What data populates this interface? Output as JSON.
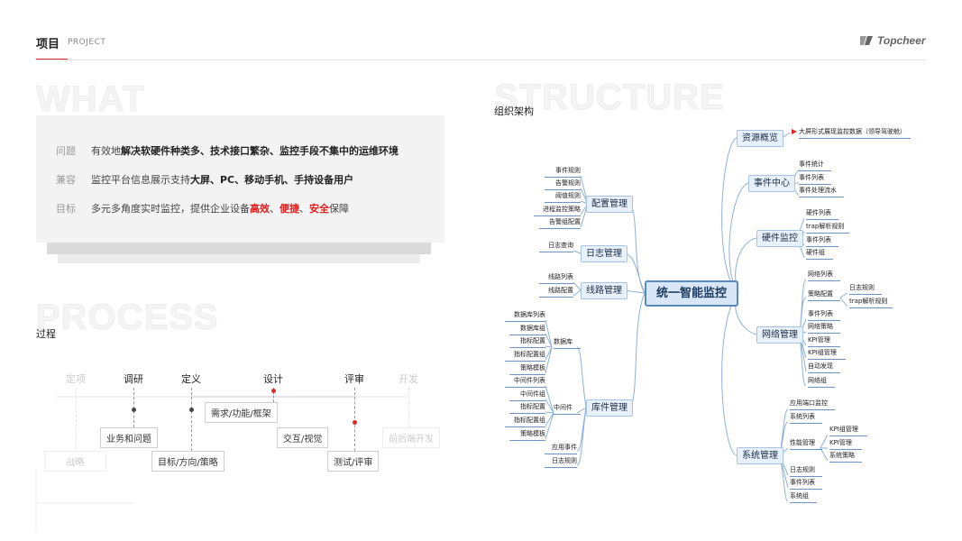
{
  "header": {
    "title": "项目",
    "subtitle": "PROJECT",
    "brand": "Topcheer"
  },
  "bg_words": {
    "what": "WHAT",
    "structure": "STRUCTURE",
    "process": "PROCESS"
  },
  "info": {
    "row1": {
      "key": "问题",
      "pre": "有效地",
      "strong": "解决软硬件种类多、技术接口繁杂、监控手段不集中的运维环境"
    },
    "row2": {
      "key": "兼容",
      "pre": "监控平台信息展示支持",
      "strong": "大屏、PC、移动手机、手持设备用户"
    },
    "row3": {
      "key": "目标",
      "pre": "多元多角度实时监控，提供企业设备",
      "red1": "高效",
      "sep1": "、",
      "red2": "便捷",
      "sep2": "、",
      "red3": "安全",
      "post": "保障"
    }
  },
  "process": {
    "label": "过程",
    "heads": [
      "定项",
      "调研",
      "定义",
      "设计",
      "评审",
      "开发"
    ],
    "boxes": {
      "strategy": "战略",
      "business": "业务和问题",
      "goals": "目标/方向/策略",
      "needs": "需求/功能/框架",
      "interaction": "交互/视觉",
      "testing": "测试/评审",
      "frontend": "前后端开发"
    }
  },
  "structure": {
    "label": "组织架构",
    "root": "统一智能监控",
    "branches": {
      "resource": "资源概览",
      "event_center": "事件中心",
      "hardware": "硬件监控",
      "network": "网络管理",
      "system": "系统管理",
      "config": "配置管理",
      "log": "日志管理",
      "line": "线路管理",
      "library": "库件管理"
    },
    "leaves": {
      "resource_1": "大屏形式展现监控数据（领导驾驶舱）",
      "event_1": "事件统计",
      "event_2": "事件列表",
      "event_3": "事件处理流水",
      "hw_1": "硬件列表",
      "hw_2": "trap解析规则",
      "hw_3": "事件列表",
      "hw_4": "硬件组",
      "net_1": "网络列表",
      "net_2": "策略配置",
      "net_2a": "日志规则",
      "net_2b": "trap解析规则",
      "net_3": "事件列表",
      "net_4": "网络策略",
      "net_5": "KPI管理",
      "net_6": "KPI组管理",
      "net_7": "自动发现",
      "net_8": "网络组",
      "sys_1": "应用端口监控",
      "sys_2": "系统列表",
      "sys_3": "性能管理",
      "sys_3a": "KPI组管理",
      "sys_3b": "KPI管理",
      "sys_3c": "系统策略",
      "sys_4": "日志规则",
      "sys_5": "事件列表",
      "sys_6": "系统组",
      "cfg_1": "事件规则",
      "cfg_2": "告警规则",
      "cfg_3": "阈值规则",
      "cfg_4": "进程监控策略",
      "cfg_5": "告警组配置",
      "log_1": "日志查询",
      "line_1": "线路列表",
      "line_2": "线路配置",
      "lib_db": "数据库",
      "lib_db_1": "数据库列表",
      "lib_db_2": "数据库组",
      "lib_db_3": "指标配置",
      "lib_db_4": "指标配置组",
      "lib_db_5": "策略模板",
      "lib_mw": "中间件",
      "lib_mw_1": "中间件列表",
      "lib_mw_2": "中间件组",
      "lib_mw_3": "指标配置",
      "lib_mw_4": "指标配置组",
      "lib_mw_5": "策略模板",
      "lib_app": "应用事件",
      "lib_log": "日志规则"
    }
  },
  "colors": {
    "accent": "#d92b2b",
    "branch_fill": "#e7f0fb",
    "branch_border": "#a8c4e4",
    "root_border": "#5a89c0",
    "connector": "#8fb0d8"
  }
}
